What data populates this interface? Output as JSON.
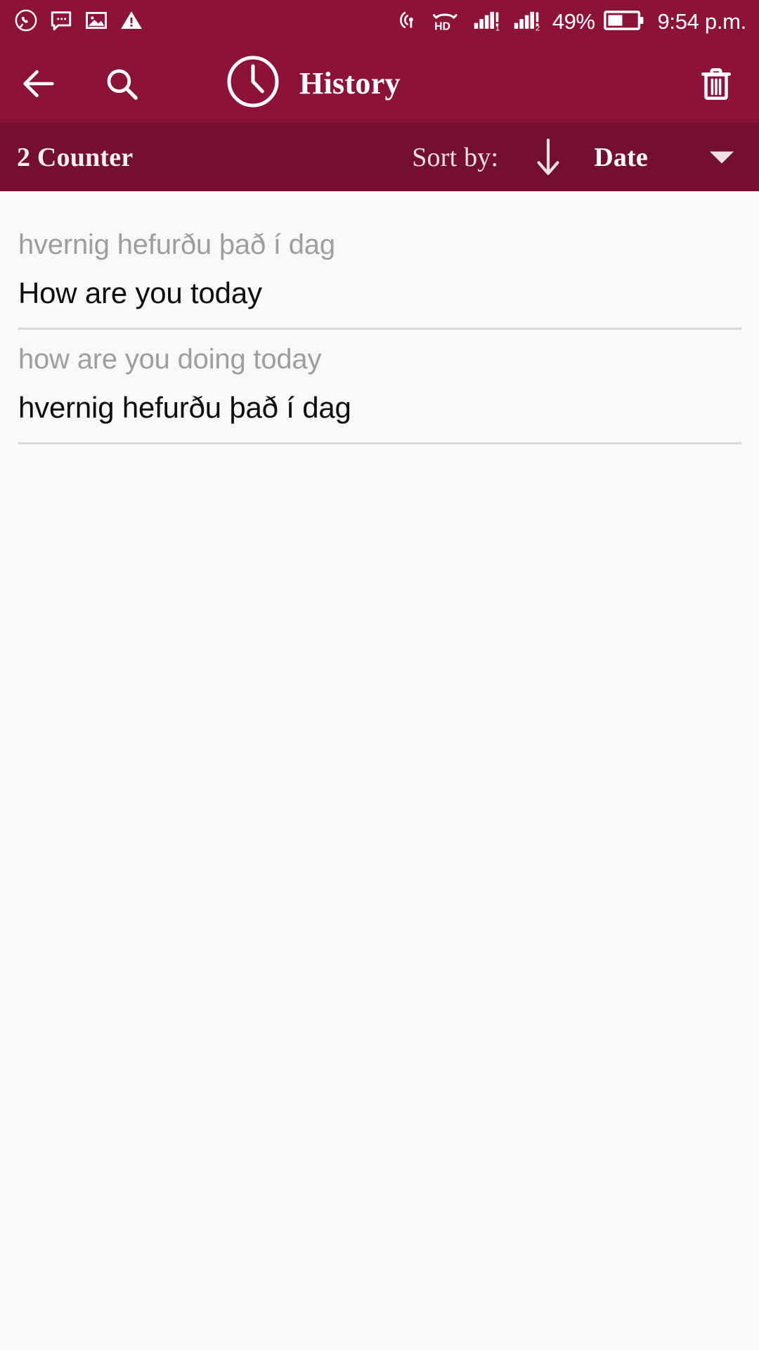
{
  "status_bar": {
    "left_icons": [
      {
        "name": "whatsapp-icon",
        "label": "WhatsApp"
      },
      {
        "name": "message-icon",
        "label": "Message"
      },
      {
        "name": "image-icon",
        "label": "Screenshot"
      },
      {
        "name": "warning-icon",
        "label": "Warning"
      }
    ],
    "right_icons": [
      {
        "name": "hotspot-icon",
        "label": "Hotspot"
      },
      {
        "name": "hd-voice-icon",
        "label": "HD"
      },
      {
        "name": "signal-sim1-icon",
        "label": "Signal SIM 1"
      },
      {
        "name": "signal-sim2-icon",
        "label": "Signal SIM 2"
      }
    ],
    "battery_percent": "49%",
    "time": "9:54 p.m."
  },
  "app_bar": {
    "back_label": "Back",
    "search_label": "Search",
    "history_icon_label": "History",
    "title": "History",
    "delete_label": "Delete all"
  },
  "sort_bar": {
    "counter": "2 Counter",
    "sort_by_label": "Sort by:",
    "sort_direction": "descending",
    "sort_value": "Date",
    "dropdown_label": "Open sort menu"
  },
  "history": {
    "items": [
      {
        "source": "hvernig hefurðu það í dag",
        "target": "How are you today"
      },
      {
        "source": "how are you doing today",
        "target": "hvernig hefurðu það í dag"
      }
    ]
  },
  "colors": {
    "app_bar": "#8b1338",
    "sort_bar": "#731030",
    "list_background": "#f8f8f8",
    "source_text": "#9e9e9e",
    "target_text": "#0d0d0d",
    "divider": "#d8d8d8"
  }
}
